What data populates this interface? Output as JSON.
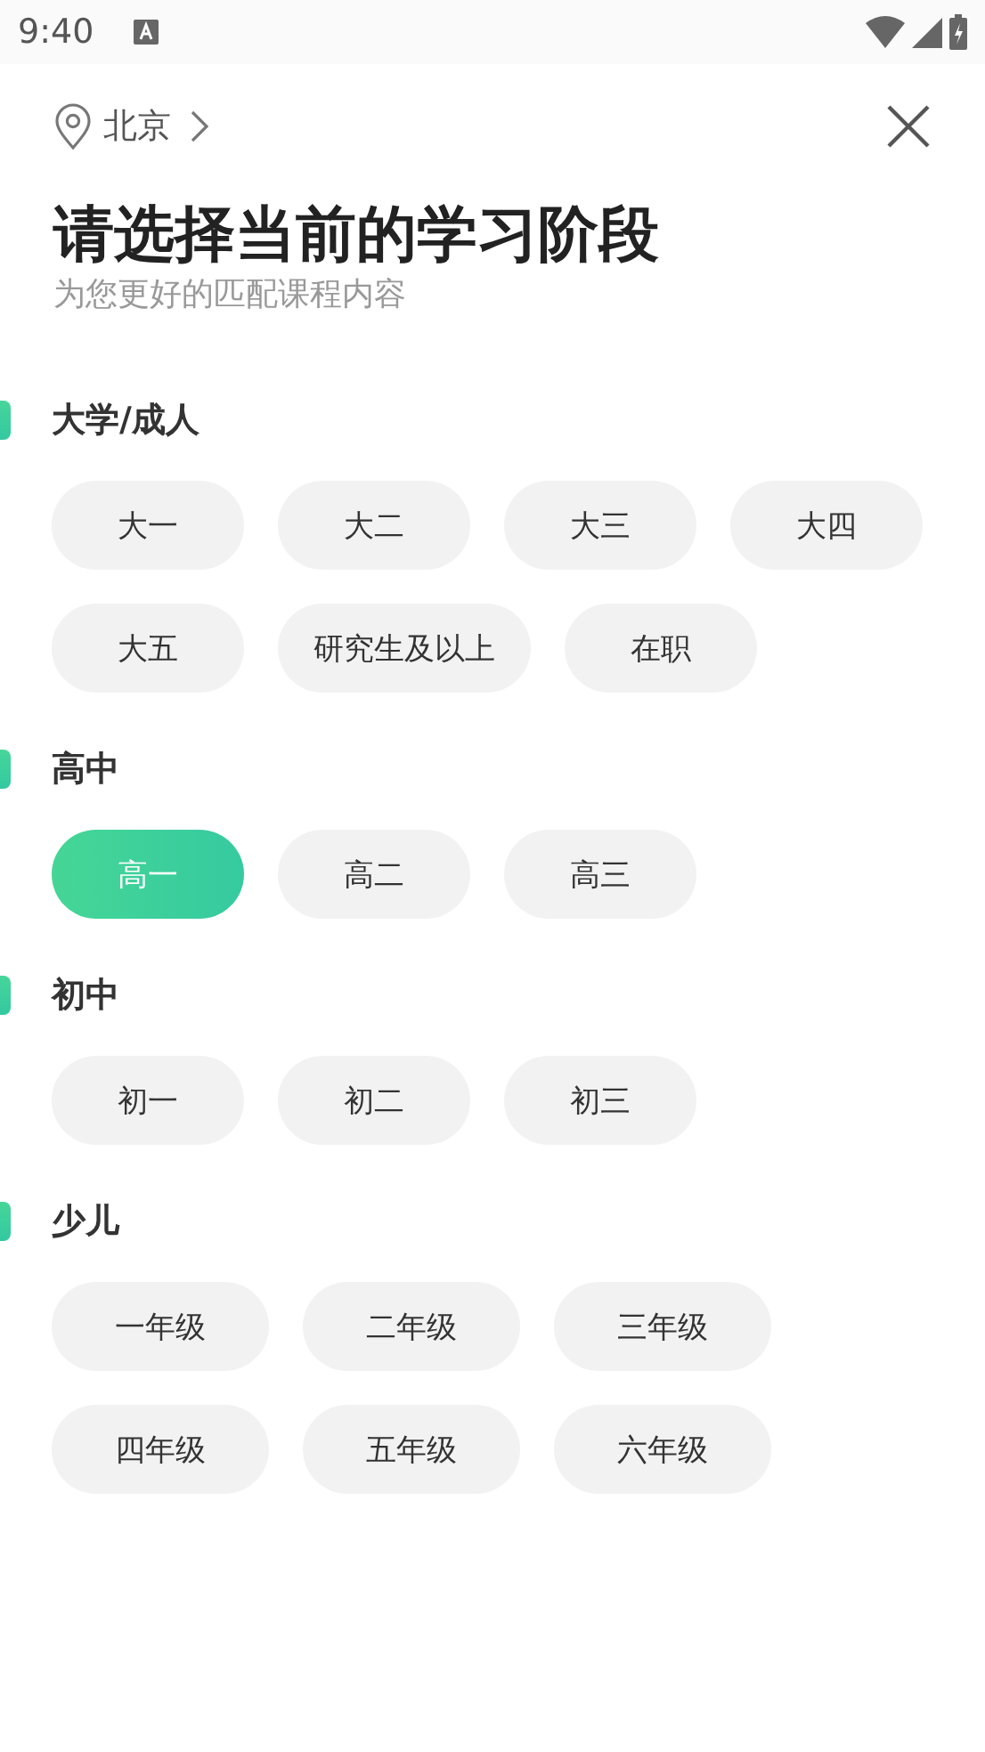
{
  "status_bar": {
    "time": "9:40"
  },
  "header": {
    "city": "北京"
  },
  "title": "请选择当前的学习阶段",
  "subtitle": "为您更好的匹配课程内容",
  "sections": [
    {
      "title": "大学/成人",
      "options": [
        {
          "label": "大一",
          "selected": false
        },
        {
          "label": "大二",
          "selected": false
        },
        {
          "label": "大三",
          "selected": false
        },
        {
          "label": "大四",
          "selected": false
        },
        {
          "label": "大五",
          "selected": false
        },
        {
          "label": "研究生及以上",
          "selected": false
        },
        {
          "label": "在职",
          "selected": false
        }
      ]
    },
    {
      "title": "高中",
      "options": [
        {
          "label": "高一",
          "selected": true
        },
        {
          "label": "高二",
          "selected": false
        },
        {
          "label": "高三",
          "selected": false
        }
      ]
    },
    {
      "title": "初中",
      "options": [
        {
          "label": "初一",
          "selected": false
        },
        {
          "label": "初二",
          "selected": false
        },
        {
          "label": "初三",
          "selected": false
        }
      ]
    },
    {
      "title": "少儿",
      "options": [
        {
          "label": "一年级",
          "selected": false
        },
        {
          "label": "二年级",
          "selected": false
        },
        {
          "label": "三年级",
          "selected": false
        },
        {
          "label": "四年级",
          "selected": false
        },
        {
          "label": "五年级",
          "selected": false
        },
        {
          "label": "六年级",
          "selected": false
        }
      ]
    }
  ]
}
